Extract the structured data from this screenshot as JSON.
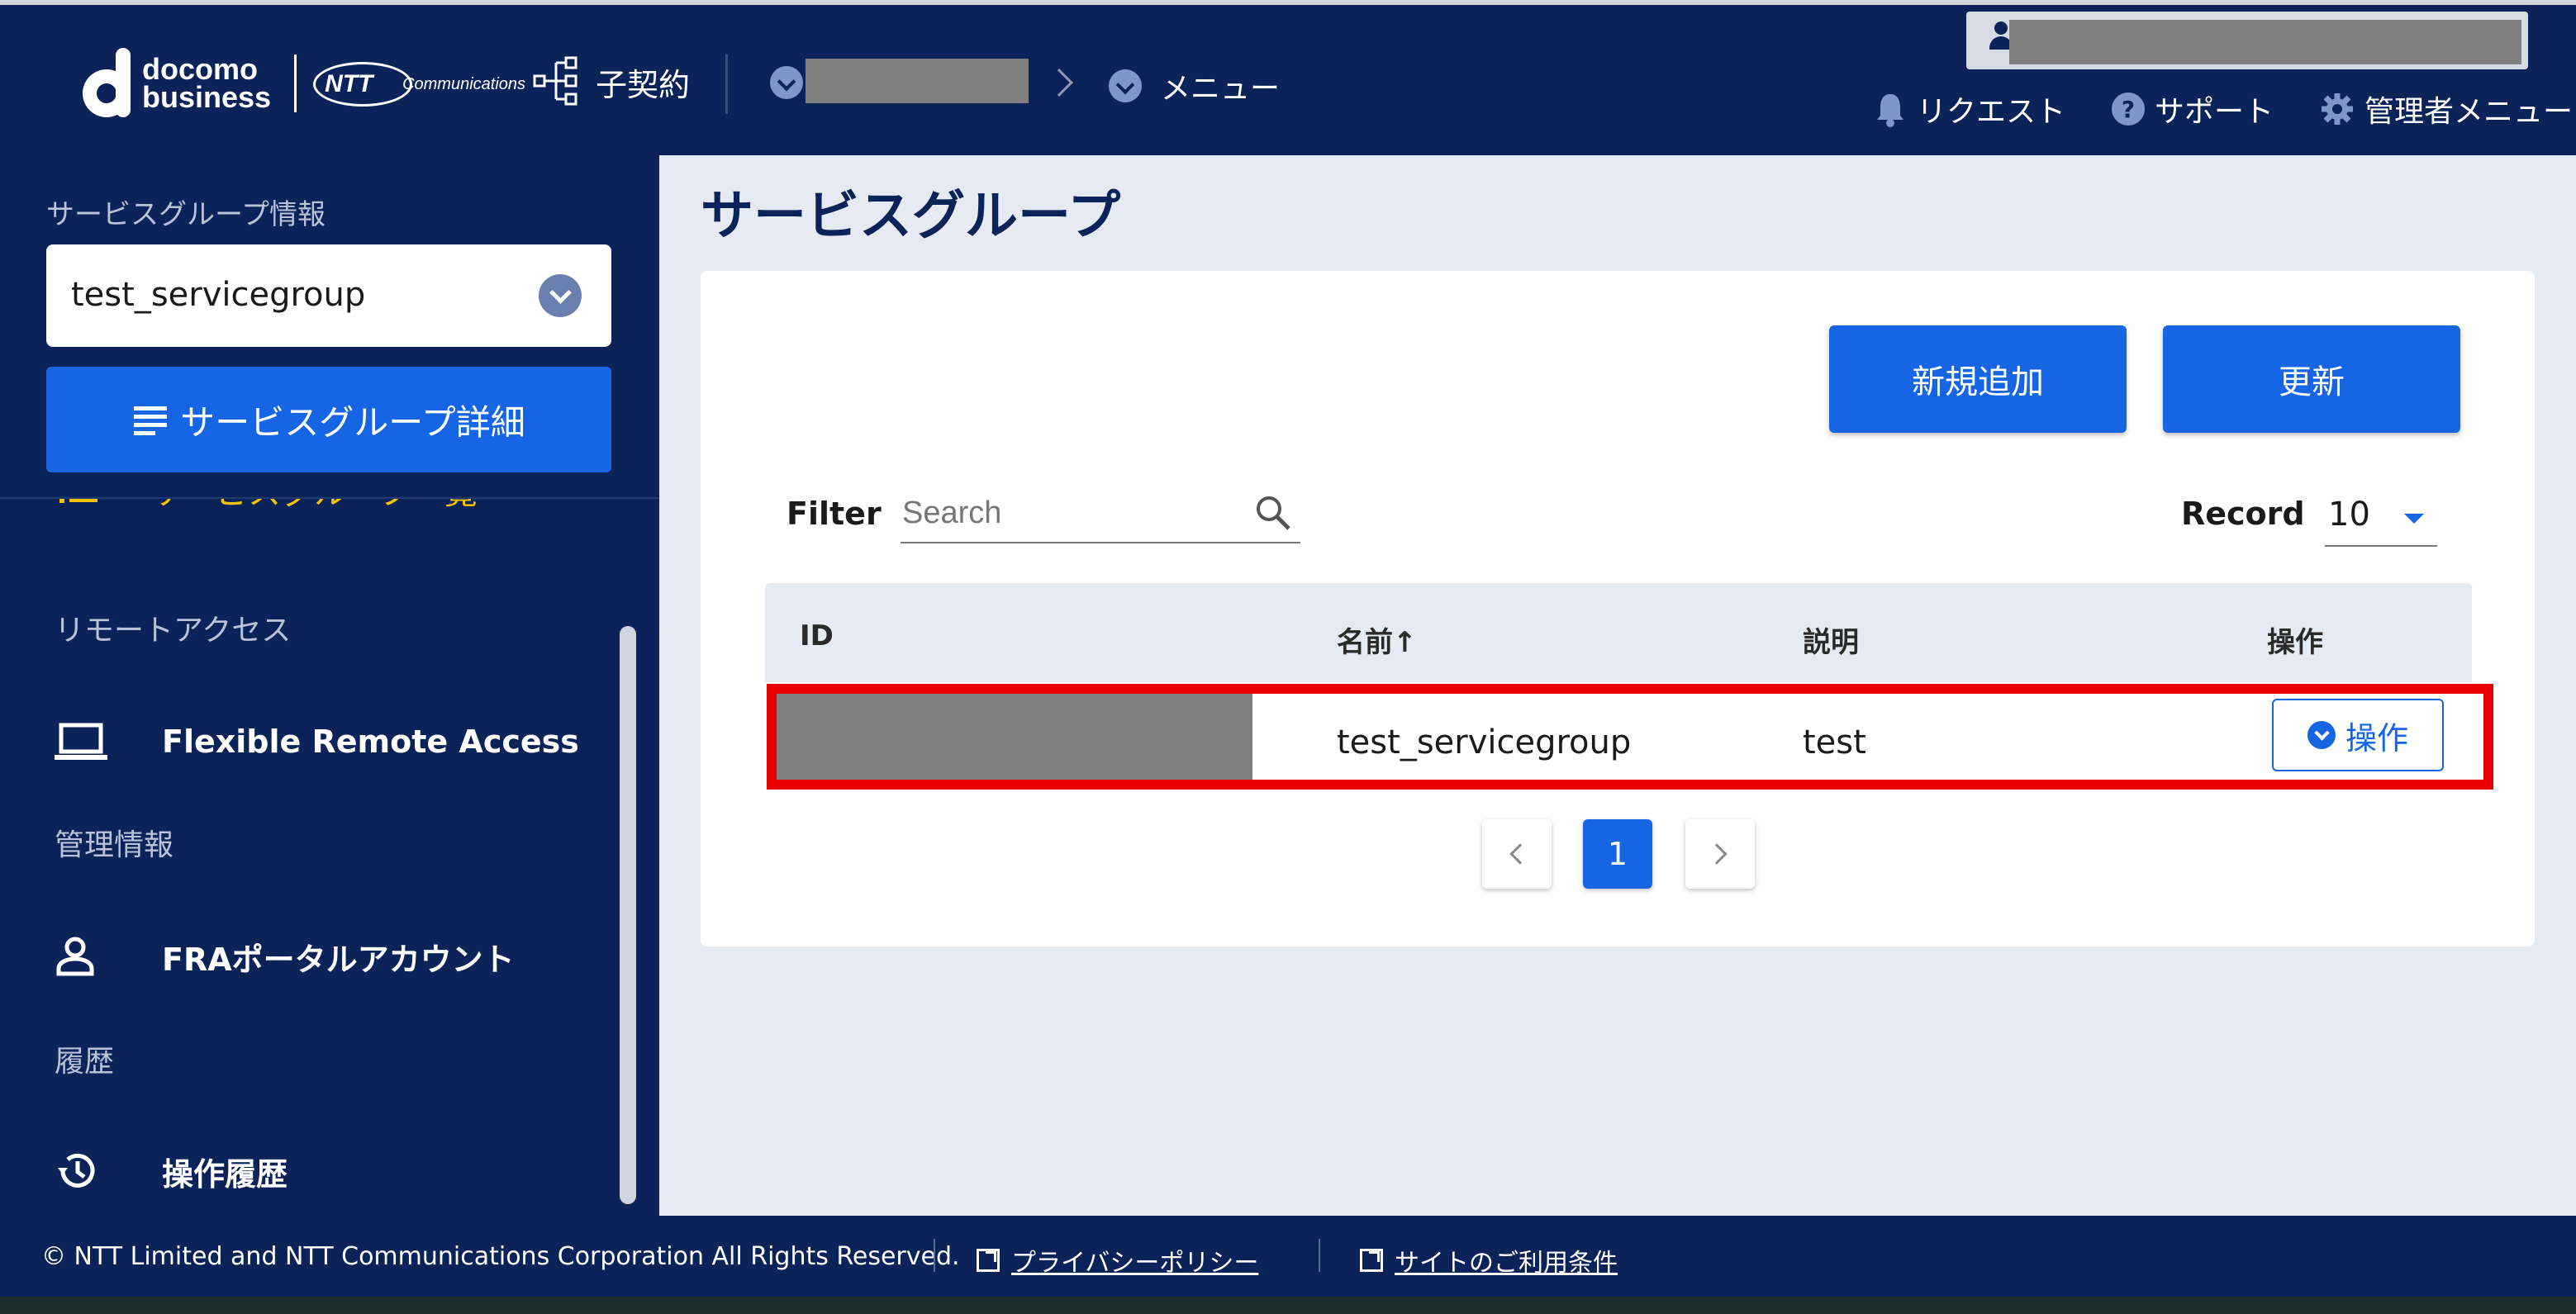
{
  "header": {
    "brand_line1": "docomo",
    "brand_line2": "business",
    "partner_logo_main": "NTT",
    "partner_logo_sub": "Communications",
    "contract_label": "子契約",
    "breadcrumb_menu": "メニュー",
    "links": {
      "request": "リクエスト",
      "support": "サポート",
      "admin_menu": "管理者メニュー"
    }
  },
  "sidebar": {
    "service_group_label": "サービスグループ情報",
    "service_group_value": "test_servicegroup",
    "detail_button": "サービスグループ詳細",
    "cut_item": "サービスグループ一覧",
    "sections": [
      {
        "title": "リモートアクセス",
        "item": "Flexible Remote Access",
        "icon": "laptop-icon"
      },
      {
        "title": "管理情報",
        "item": "FRAポータルアカウント",
        "icon": "person-icon"
      },
      {
        "title": "履歴",
        "item": "操作履歴",
        "icon": "history-icon"
      }
    ]
  },
  "main": {
    "title": "サービスグループ",
    "buttons": {
      "add": "新規追加",
      "refresh": "更新"
    },
    "filter_label": "Filter",
    "search_placeholder": "Search",
    "record_label": "Record",
    "record_value": "10",
    "table": {
      "headers": [
        "ID",
        "名前↑",
        "説明",
        "操作"
      ],
      "rows": [
        {
          "id": "",
          "name": "test_servicegroup",
          "description": "test",
          "action": "操作"
        }
      ]
    },
    "pagination": {
      "current": "1"
    }
  },
  "footer": {
    "copyright": "© NTT Limited and NTT Communications Corporation All Rights Reserved.",
    "privacy": "プライバシーポリシー",
    "terms": "サイトのご利用条件"
  },
  "colors": {
    "navy": "#0b2358",
    "primary": "#1565e5",
    "highlight": "#e60000",
    "background": "#e5eaf3"
  }
}
